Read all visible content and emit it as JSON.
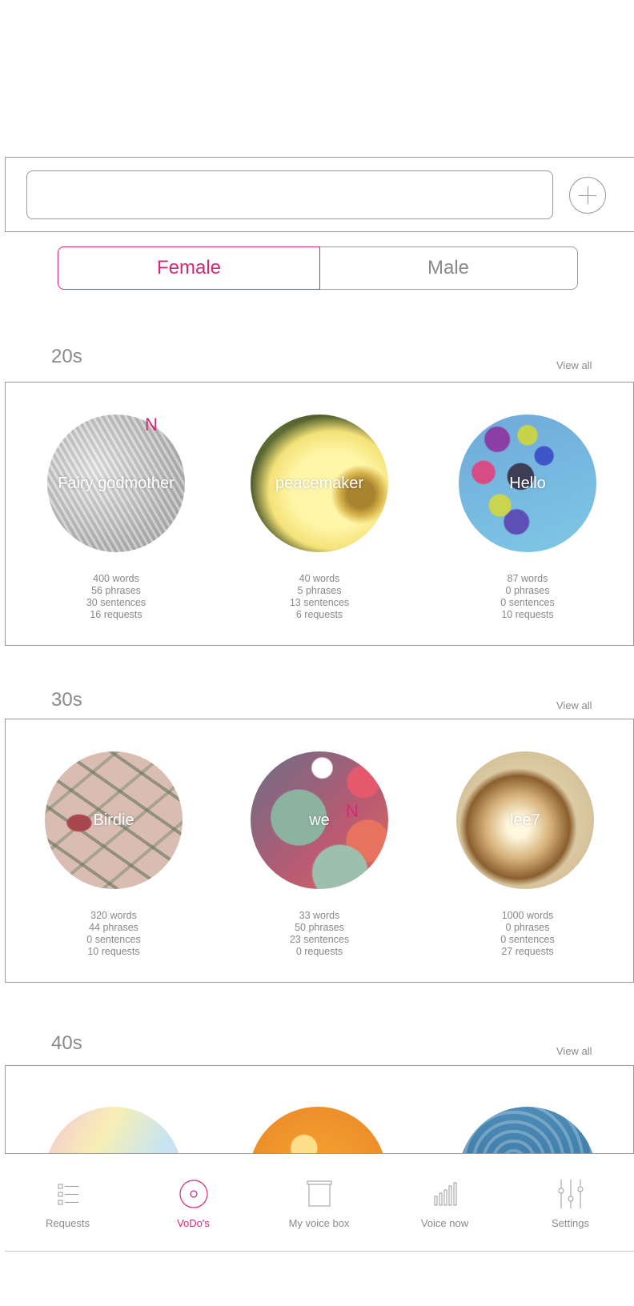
{
  "search": {
    "value": "",
    "placeholder": ""
  },
  "gender_toggle": {
    "female_label": "Female",
    "male_label": "Male",
    "selected": "Female"
  },
  "sections": [
    {
      "title": "20s",
      "view_all_label": "View all",
      "voices": [
        {
          "name": "Fairy godmother",
          "is_new": true,
          "new_badge": "N",
          "image": "knitted-wool",
          "stats": [
            "400 words",
            "56 phrases",
            "30 sentences",
            "16 requests"
          ]
        },
        {
          "name": "peacemaker",
          "is_new": false,
          "image": "yellow-flower",
          "stats": [
            "40 words",
            "5 phrases",
            "13 sentences",
            "6 requests"
          ]
        },
        {
          "name": "Hello",
          "is_new": false,
          "image": "balloons",
          "stats": [
            "87 words",
            "0 phrases",
            "0 sentences",
            "10 requests"
          ]
        }
      ]
    },
    {
      "title": "30s",
      "view_all_label": "View all",
      "voices": [
        {
          "name": "Birdie",
          "is_new": false,
          "image": "bird-wallpaper",
          "stats": [
            "320 words",
            "44 phrases",
            "0 sentences",
            "10 requests"
          ]
        },
        {
          "name": "we",
          "is_new": true,
          "new_badge": "N",
          "image": "paper-lanterns",
          "stats": [
            "33 words",
            "50 phrases",
            "23 sentences",
            "0 requests"
          ]
        },
        {
          "name": "lee7",
          "is_new": false,
          "image": "glass-heart",
          "stats": [
            "1000 words",
            "0 phrases",
            "0 sentences",
            "27 requests"
          ]
        }
      ]
    },
    {
      "title": "40s",
      "view_all_label": "View all",
      "voices": [
        {
          "image": "pastel-prism"
        },
        {
          "image": "orange-bokeh"
        },
        {
          "image": "water-surface"
        }
      ]
    }
  ],
  "tab_bar": {
    "tabs": [
      {
        "label": "Requests",
        "icon": "list-icon",
        "active": false
      },
      {
        "label": "VoDo's",
        "icon": "target-icon",
        "active": true
      },
      {
        "label": "My voice box",
        "icon": "box-icon",
        "active": false
      },
      {
        "label": "Voice now",
        "icon": "sound-bars-icon",
        "active": false
      },
      {
        "label": "Settings",
        "icon": "sliders-icon",
        "active": false
      }
    ]
  },
  "colors": {
    "accent": "#d6287a",
    "border": "#9a9a9a",
    "text_muted": "#888888"
  }
}
